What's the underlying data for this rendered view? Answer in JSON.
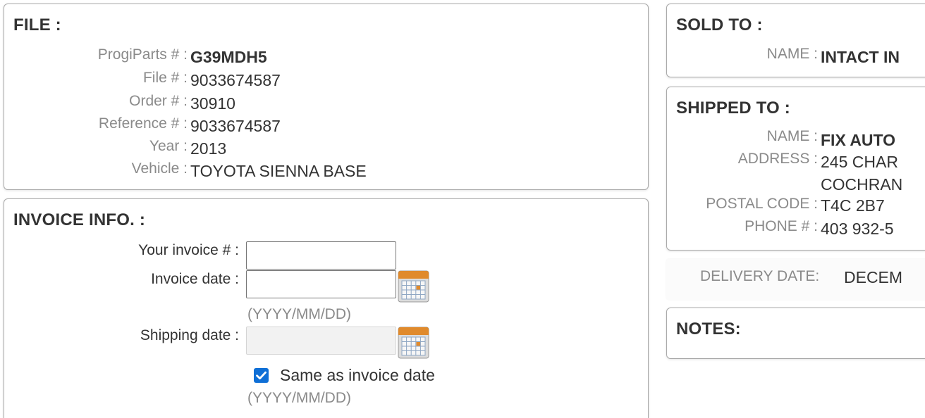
{
  "file": {
    "title": "FILE :",
    "rows": [
      {
        "label": "ProgiParts # :",
        "value": "G39MDH5",
        "bold": true
      },
      {
        "label": "File # :",
        "value": "9033674587"
      },
      {
        "label": "Order # :",
        "value": "30910"
      },
      {
        "label": "Reference # :",
        "value": "9033674587"
      },
      {
        "label": "Year :",
        "value": "2013"
      },
      {
        "label": "Vehicle :",
        "value": "TOYOTA SIENNA BASE"
      }
    ]
  },
  "invoice": {
    "title": "INVOICE INFO. :",
    "invoice_number_label": "Your invoice # :",
    "invoice_number_value": "",
    "invoice_date_label": "Invoice date :",
    "invoice_date_value": "",
    "invoice_date_hint": "(YYYY/MM/DD)",
    "shipping_date_label": "Shipping date :",
    "shipping_date_value": "",
    "same_as_invoice_label": "Same as invoice date",
    "same_as_invoice_checked": true,
    "shipping_date_hint": "(YYYY/MM/DD)",
    "calendar_icon": "calendar-icon"
  },
  "sold_to": {
    "title": "SOLD TO :",
    "name_label": "NAME :",
    "name_value": "INTACT IN"
  },
  "shipped_to": {
    "title": "SHIPPED TO :",
    "name_label": "NAME :",
    "name_value": "FIX AUTO",
    "address_label": "ADDRESS :",
    "address_line1": "245 CHAR",
    "address_line2": "COCHRAN",
    "postal_label": "POSTAL CODE :",
    "postal_value": "T4C 2B7",
    "phone_label": "PHONE # :",
    "phone_value": "403 932-5"
  },
  "delivery": {
    "label": "DELIVERY DATE:",
    "value": "DECEM"
  },
  "notes": {
    "title": "NOTES:"
  },
  "colors": {
    "accent": "#0f6fd6",
    "label_gray": "#8a8a8a",
    "text": "#333333",
    "border": "#a9a9a9"
  }
}
